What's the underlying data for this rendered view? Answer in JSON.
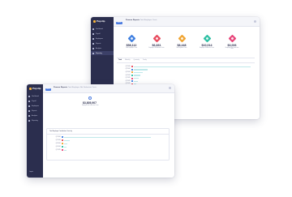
{
  "back_window": {
    "brand": "Payslip",
    "nav": [
      {
        "icon": "home-icon",
        "label": "Dashboard"
      },
      {
        "icon": "payroll-icon",
        "label": "Payroll"
      },
      {
        "icon": "employees-icon",
        "label": "Employees"
      },
      {
        "icon": "reports-icon",
        "label": "Reports"
      },
      {
        "icon": "analytics-icon",
        "label": "Analytics"
      },
      {
        "icon": "reporting-icon",
        "label": "Reporting",
        "active": true
      }
    ],
    "back_label": "Back",
    "title": "Finance Reports",
    "subtitle": "Total Employer Costs",
    "stats": [
      {
        "value": "$58,112",
        "label": "Total Employer Costs",
        "color": "#3f7fe0"
      },
      {
        "value": "$6,831",
        "label": "Employer Contribution Costs",
        "color": "#e84b5e"
      },
      {
        "value": "$8,448",
        "label": "Net Payment Costs",
        "color": "#f0a431"
      },
      {
        "value": "$10,014",
        "label": "Employee Deduction Costs",
        "color": "#2fc0a4"
      },
      {
        "value": "$3,006",
        "label": "Employee Tax Deduction Costs",
        "color": "#e8457a"
      }
    ],
    "tabs": [
      "Total",
      "Monthly",
      "Quarterly",
      "Yearly"
    ],
    "bar_rows": [
      {
        "label": "Q1 2024",
        "chip": "#e84b5e",
        "fill": 0.96
      },
      {
        "label": "Q2 2024",
        "chip": "#3f7fe0",
        "fill": 0.11
      },
      {
        "label": "Q3 2024",
        "chip": "#f0a431",
        "fill": 0.07
      },
      {
        "label": "Q4 2024",
        "chip": "#2fc0a4",
        "fill": 0.05
      },
      {
        "label": "Q1 2025",
        "chip": "#e8457a",
        "fill": 0.04
      },
      {
        "label": "Q2 2025",
        "chip": "#3f7fe0",
        "fill": 0.03
      },
      {
        "label": "Q3 2025",
        "chip": "#e84b5e",
        "fill": 0.02
      },
      {
        "label": "Q4 2025",
        "chip": "#f0a431",
        "fill": 0.02
      }
    ]
  },
  "front_window": {
    "brand": "Payslip",
    "nav": [
      {
        "icon": "home-icon",
        "label": "Dashboard"
      },
      {
        "icon": "payroll-icon",
        "label": "Payroll"
      },
      {
        "icon": "employees-icon",
        "label": "Employees"
      },
      {
        "icon": "reports-icon",
        "label": "Reports"
      },
      {
        "icon": "analytics-icon",
        "label": "Analytics"
      },
      {
        "icon": "reporting-icon",
        "label": "Reporting"
      }
    ],
    "back_label": "Back",
    "title": "Finance Reports",
    "subtitle": "Total Employer Net Deduction Costs",
    "kpi_value": "$3,805,907",
    "kpi_label": "Employer Net Deduction Costs",
    "card_title": "Total Employer Contribution Costs by",
    "bar_rows": [
      {
        "label": "Q1 2024",
        "chip": "#3f7fe0",
        "fill": 0.97
      },
      {
        "label": "Q2 2024",
        "chip": "#e84b5e",
        "fill": 0.06
      },
      {
        "label": "Q3 2024",
        "chip": "#f0a431",
        "fill": 0.04
      },
      {
        "label": "Q4 2024",
        "chip": "#2fc0a4",
        "fill": 0.03
      },
      {
        "label": "Q1 2025",
        "chip": "#e8457a",
        "fill": 0.03
      }
    ],
    "logout": "Logout"
  }
}
